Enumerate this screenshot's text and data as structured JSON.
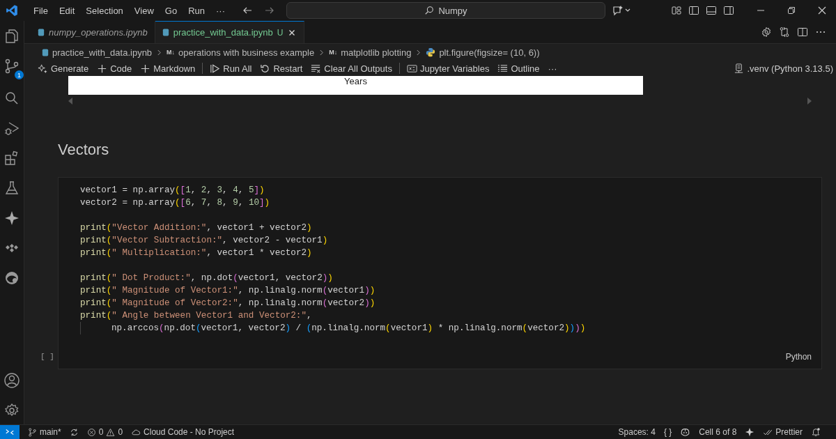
{
  "menu": [
    "File",
    "Edit",
    "Selection",
    "View",
    "Go",
    "Run",
    "···"
  ],
  "command_center": {
    "value": "Numpy"
  },
  "activity_bar": {
    "badge": "1"
  },
  "tabs": [
    {
      "label": "numpy_operations.ipynb",
      "selected": false,
      "preview": true
    },
    {
      "label": "practice_with_data.ipynb",
      "selected": true,
      "preview": false,
      "status": "U"
    }
  ],
  "breadcrumbs": [
    {
      "kind": "notebook",
      "label": "practice_with_data.ipynb"
    },
    {
      "kind": "markdown",
      "glyph": "M↓",
      "label": "operations with business example"
    },
    {
      "kind": "markdown",
      "glyph": "M↓",
      "label": "matplotlib plotting"
    },
    {
      "kind": "python",
      "label": "plt.figure(figsize= (10, 6))"
    }
  ],
  "toolbar": [
    {
      "kind": "generate",
      "label": "Generate"
    },
    {
      "kind": "add",
      "label": "Code"
    },
    {
      "kind": "add",
      "label": "Markdown"
    },
    {
      "kind": "separator"
    },
    {
      "kind": "run",
      "label": "Run All"
    },
    {
      "kind": "restart",
      "label": "Restart"
    },
    {
      "kind": "clear",
      "label": "Clear All Outputs"
    },
    {
      "kind": "separator"
    },
    {
      "kind": "variables",
      "label": "Jupyter Variables"
    },
    {
      "kind": "outline",
      "label": "Outline"
    },
    {
      "kind": "more",
      "label": "···"
    }
  ],
  "kernel": ".venv (Python 3.13.5)",
  "output_fragment": {
    "xlabel": "Years"
  },
  "heading": "Vectors",
  "cell": {
    "execution_count": "[ ]",
    "language": "Python",
    "blocks": [
      [
        [
          {
            "kind": "text",
            "t": "vector1 = np.array"
          },
          {
            "kind": "b1",
            "t": "("
          },
          {
            "kind": "b2",
            "t": "["
          },
          {
            "kind": "num",
            "t": "1"
          },
          {
            "kind": "text",
            "t": ", "
          },
          {
            "kind": "num",
            "t": "2"
          },
          {
            "kind": "text",
            "t": ", "
          },
          {
            "kind": "num",
            "t": "3"
          },
          {
            "kind": "text",
            "t": ", "
          },
          {
            "kind": "num",
            "t": "4"
          },
          {
            "kind": "text",
            "t": ", "
          },
          {
            "kind": "num",
            "t": "5"
          },
          {
            "kind": "b2",
            "t": "]"
          },
          {
            "kind": "b1",
            "t": ")"
          }
        ],
        [
          {
            "kind": "text",
            "t": "vector2 = np.array"
          },
          {
            "kind": "b1",
            "t": "("
          },
          {
            "kind": "b2",
            "t": "["
          },
          {
            "kind": "num",
            "t": "6"
          },
          {
            "kind": "text",
            "t": ", "
          },
          {
            "kind": "num",
            "t": "7"
          },
          {
            "kind": "text",
            "t": ", "
          },
          {
            "kind": "num",
            "t": "8"
          },
          {
            "kind": "text",
            "t": ", "
          },
          {
            "kind": "num",
            "t": "9"
          },
          {
            "kind": "text",
            "t": ", "
          },
          {
            "kind": "num",
            "t": "10"
          },
          {
            "kind": "b2",
            "t": "]"
          },
          {
            "kind": "b1",
            "t": ")"
          }
        ]
      ],
      [
        [
          {
            "kind": "fn",
            "t": "print"
          },
          {
            "kind": "b1",
            "t": "("
          },
          {
            "kind": "str",
            "t": "\"Vector Addition:\""
          },
          {
            "kind": "text",
            "t": ", vector1 + vector2"
          },
          {
            "kind": "b1",
            "t": ")"
          }
        ],
        [
          {
            "kind": "fn",
            "t": "print"
          },
          {
            "kind": "b1",
            "t": "("
          },
          {
            "kind": "str",
            "t": "\"Vector Subtraction:\""
          },
          {
            "kind": "text",
            "t": ", vector2 - vector1"
          },
          {
            "kind": "b1",
            "t": ")"
          }
        ],
        [
          {
            "kind": "fn",
            "t": "print"
          },
          {
            "kind": "b1",
            "t": "("
          },
          {
            "kind": "str",
            "t": "\" Multiplication:\""
          },
          {
            "kind": "text",
            "t": ", vector1 * vector2"
          },
          {
            "kind": "b1",
            "t": ")"
          }
        ]
      ],
      [
        [
          {
            "kind": "fn",
            "t": "print"
          },
          {
            "kind": "b1",
            "t": "("
          },
          {
            "kind": "str",
            "t": "\" Dot Product:\""
          },
          {
            "kind": "text",
            "t": ", np.dot"
          },
          {
            "kind": "b2",
            "t": "("
          },
          {
            "kind": "text",
            "t": "vector1, vector2"
          },
          {
            "kind": "b2",
            "t": ")"
          },
          {
            "kind": "b1",
            "t": ")"
          }
        ],
        [
          {
            "kind": "fn",
            "t": "print"
          },
          {
            "kind": "b1",
            "t": "("
          },
          {
            "kind": "str",
            "t": "\" Magnitude of Vector1:\""
          },
          {
            "kind": "text",
            "t": ", np.linalg.norm"
          },
          {
            "kind": "b2",
            "t": "("
          },
          {
            "kind": "text",
            "t": "vector1"
          },
          {
            "kind": "b2",
            "t": ")"
          },
          {
            "kind": "b1",
            "t": ")"
          }
        ],
        [
          {
            "kind": "fn",
            "t": "print"
          },
          {
            "kind": "b1",
            "t": "("
          },
          {
            "kind": "str",
            "t": "\" Magnitude of Vector2:\""
          },
          {
            "kind": "text",
            "t": ", np.linalg.norm"
          },
          {
            "kind": "b2",
            "t": "("
          },
          {
            "kind": "text",
            "t": "vector2"
          },
          {
            "kind": "b2",
            "t": ")"
          },
          {
            "kind": "b1",
            "t": ")"
          }
        ],
        [
          {
            "kind": "fn",
            "t": "print"
          },
          {
            "kind": "b1",
            "t": "("
          },
          {
            "kind": "str",
            "t": "\" Angle between Vector1 and Vector2:\""
          },
          {
            "kind": "text",
            "t": ","
          }
        ],
        {
          "continuation": true,
          "tokens": [
            {
              "kind": "text",
              "t": "np.arccos"
            },
            {
              "kind": "b2",
              "t": "("
            },
            {
              "kind": "text",
              "t": "np.dot"
            },
            {
              "kind": "b3",
              "t": "("
            },
            {
              "kind": "text",
              "t": "vector1, vector2"
            },
            {
              "kind": "b3",
              "t": ")"
            },
            {
              "kind": "text",
              "t": " / "
            },
            {
              "kind": "b3",
              "t": "("
            },
            {
              "kind": "text",
              "t": "np.linalg.norm"
            },
            {
              "kind": "b1",
              "t": "("
            },
            {
              "kind": "text",
              "t": "vector1"
            },
            {
              "kind": "b1",
              "t": ")"
            },
            {
              "kind": "text",
              "t": " * np.linalg.norm"
            },
            {
              "kind": "b1",
              "t": "("
            },
            {
              "kind": "text",
              "t": "vector2"
            },
            {
              "kind": "b1",
              "t": ")"
            },
            {
              "kind": "b3",
              "t": ")"
            },
            {
              "kind": "b2",
              "t": ")"
            },
            {
              "kind": "b1",
              "t": ")"
            }
          ]
        }
      ]
    ]
  },
  "status_bar": {
    "branch": "main*",
    "errors": "0",
    "warnings": "0",
    "cloud": "Cloud Code - No Project",
    "spaces": "Spaces: 4",
    "braces": "{ }",
    "cell": "Cell 6 of 8",
    "formatter": "Prettier"
  }
}
